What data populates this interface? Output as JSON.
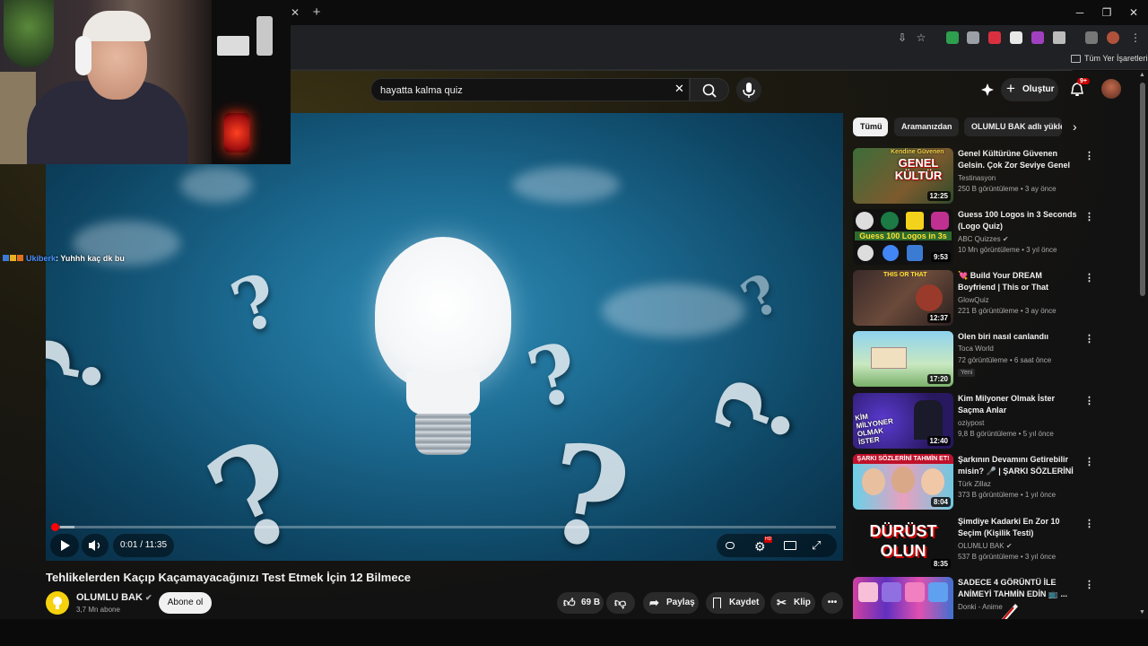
{
  "browser": {
    "bookmarks_label": "Tüm Yer İşaretleri"
  },
  "youtube": {
    "search": {
      "value": "hayatta kalma quiz"
    },
    "create_label": "Oluştur",
    "notifications_count": "9+"
  },
  "player": {
    "time": "0:01 / 11:35",
    "progress": 0.0014,
    "hd_badge": "HD"
  },
  "video": {
    "title": "Tehlikelerden Kaçıp Kaçamayacağınızı Test Etmek İçin 12 Bilmece",
    "channel": "OLUMLU BAK",
    "subscribers": "3,7 Mn abone",
    "subscribe_label": "Abone ol",
    "likes": "69 B",
    "share_label": "Paylaş",
    "save_label": "Kaydet",
    "clip_label": "Klip"
  },
  "chat": {
    "user": "Ukiberk",
    "message": ": Yuhhh kaç dk bu"
  },
  "chips": [
    "Tümü",
    "Aramanızdan",
    "OLUMLU BAK adlı yükleyiciden"
  ],
  "recommendations": [
    {
      "title": "Genel Kültürüne Güvenen Gelsin. Çok Zor Seviye Genel ...",
      "channel": "Testinasyon",
      "meta": "250 B görüntüleme • 3 ay önce",
      "duration": "12:25",
      "thumb_text": "GENEL KÜLTÜR",
      "thumb_top": "Kendine Güvenen",
      "verified": false
    },
    {
      "title": "Guess 100 Logos in 3 Seconds (Logo Quiz)",
      "channel": "ABC Quizzes",
      "meta": "10 Mn görüntüleme • 3 yıl önce",
      "duration": "9:53",
      "thumb_text": "Guess 100 Logos in 3s",
      "verified": true
    },
    {
      "title": "💘 Build Your DREAM Boyfriend | This or That",
      "channel": "GlowQuiz",
      "meta": "221 B görüntüleme • 3 ay önce",
      "duration": "12:37",
      "thumb_text": "THIS OR THAT",
      "verified": false
    },
    {
      "title": "Olen biri nasıl canlandıı",
      "channel": "Toca World",
      "meta": "72 görüntüleme • 6 saat önce",
      "duration": "17:20",
      "badge": "Yeni",
      "verified": false
    },
    {
      "title": "Kim Milyoner Olmak İster Saçma Anlar",
      "channel": "oziypost",
      "meta": "9,8 B görüntüleme • 5 yıl önce",
      "duration": "12:40",
      "thumb_text": "KİM MİLYONER OLMAK İSTER",
      "verified": false
    },
    {
      "title": "Şarkının Devamını Getirebilir misin? 🎤 | ŞARKI SÖZLERİNİ ...",
      "channel": "Türk Zillaz",
      "meta": "373 B görüntüleme • 1 yıl önce",
      "duration": "8:04",
      "thumb_text": "ŞARKI SÖZLERİNİ TAHMİN ET!",
      "verified": false
    },
    {
      "title": "Şimdiye Kadarki En Zor 10 Seçim (Kişilik Testi)",
      "channel": "OLUMLU BAK",
      "meta": "537 B görüntüleme • 3 yıl önce",
      "duration": "8:35",
      "thumb_text": "DÜRÜST OLUN",
      "verified": true
    },
    {
      "title": "SADECE 4 GÖRÜNTÜ İLE ANİMEYİ TAHMİN EDİN 📺 ...",
      "channel": "Donki - Anime",
      "meta": "",
      "duration": "",
      "verified": false
    }
  ],
  "colors": {
    "accent": "#ff0000",
    "bg": "#0f0f0f",
    "text": "#f1f1f1",
    "muted": "#aaaaaa"
  }
}
